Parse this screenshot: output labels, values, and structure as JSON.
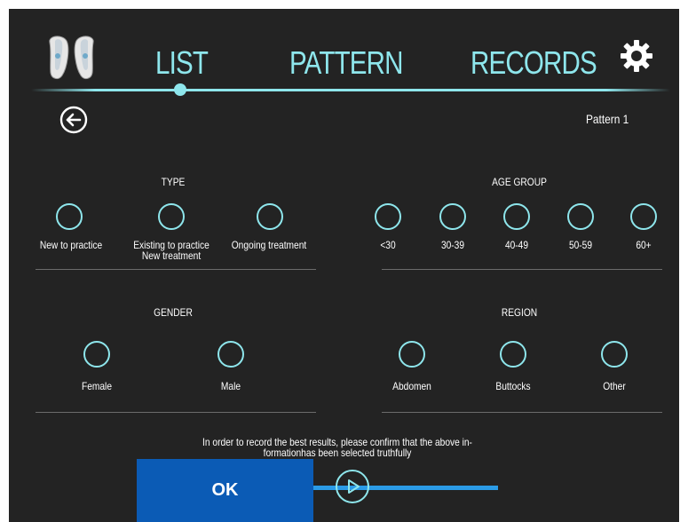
{
  "nav": {
    "tabs": [
      "LIST",
      "PATTERN",
      "RECORDS"
    ],
    "active_tab": "LIST"
  },
  "subheader": {
    "pattern_label": "Pattern 1"
  },
  "sections": {
    "type": {
      "title": "TYPE",
      "options": [
        "New to practice",
        "Existing to practice",
        "New treatment",
        "Ongoing treatment"
      ]
    },
    "age_group": {
      "title": "AGE GROUP",
      "options": [
        "<30",
        "30-39",
        "40-49",
        "50-59",
        "60+"
      ]
    },
    "gender": {
      "title": "GENDER",
      "options": [
        "Female",
        "Male"
      ]
    },
    "region": {
      "title": "REGION",
      "options": [
        "Abdomen",
        "Buttocks",
        "Other"
      ]
    }
  },
  "footer": {
    "notice_line1": "In order to record the best results, please confirm that the above in-",
    "notice_line2": "formationhas been selected truthfully",
    "ok_label": "OK"
  },
  "colors": {
    "accent": "#8ee6ec",
    "background": "#232323",
    "ok_button": "#0b5bb5",
    "progress": "#2b9be6"
  },
  "icons": [
    "earbuds-icon",
    "gear-icon",
    "back-arrow-icon",
    "play-icon"
  ]
}
